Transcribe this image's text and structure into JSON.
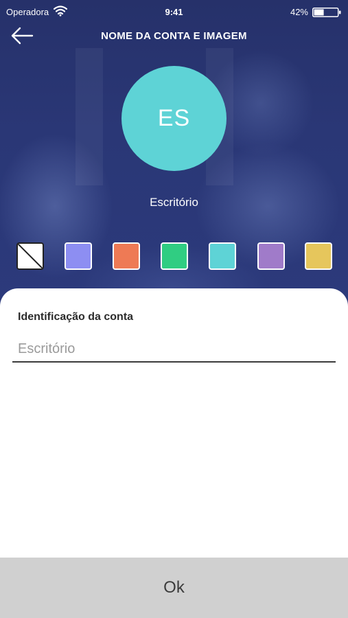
{
  "status_bar": {
    "carrier": "Operadora",
    "time": "9:41",
    "battery_percent": "42%",
    "battery_level": 0.42,
    "icons": [
      "wifi-icon",
      "battery-icon"
    ]
  },
  "nav": {
    "title": "NOME DA CONTA E IMAGEM",
    "back_icon": "arrow-left-icon"
  },
  "avatar": {
    "initials": "ES",
    "color": "#5ed3d6"
  },
  "account_label": "Escritório",
  "swatches": [
    {
      "name": "none",
      "color": "#ffffff"
    },
    {
      "name": "blue",
      "color": "#8d8ef2"
    },
    {
      "name": "orange",
      "color": "#ee7a55"
    },
    {
      "name": "green",
      "color": "#30cd82"
    },
    {
      "name": "cyan",
      "color": "#5ed3d6"
    },
    {
      "name": "purple",
      "color": "#a07bc9"
    },
    {
      "name": "yellow",
      "color": "#e6c65c"
    }
  ],
  "form": {
    "label": "Identificação da conta",
    "placeholder": "Escritório",
    "value": ""
  },
  "ok_label": "Ok"
}
